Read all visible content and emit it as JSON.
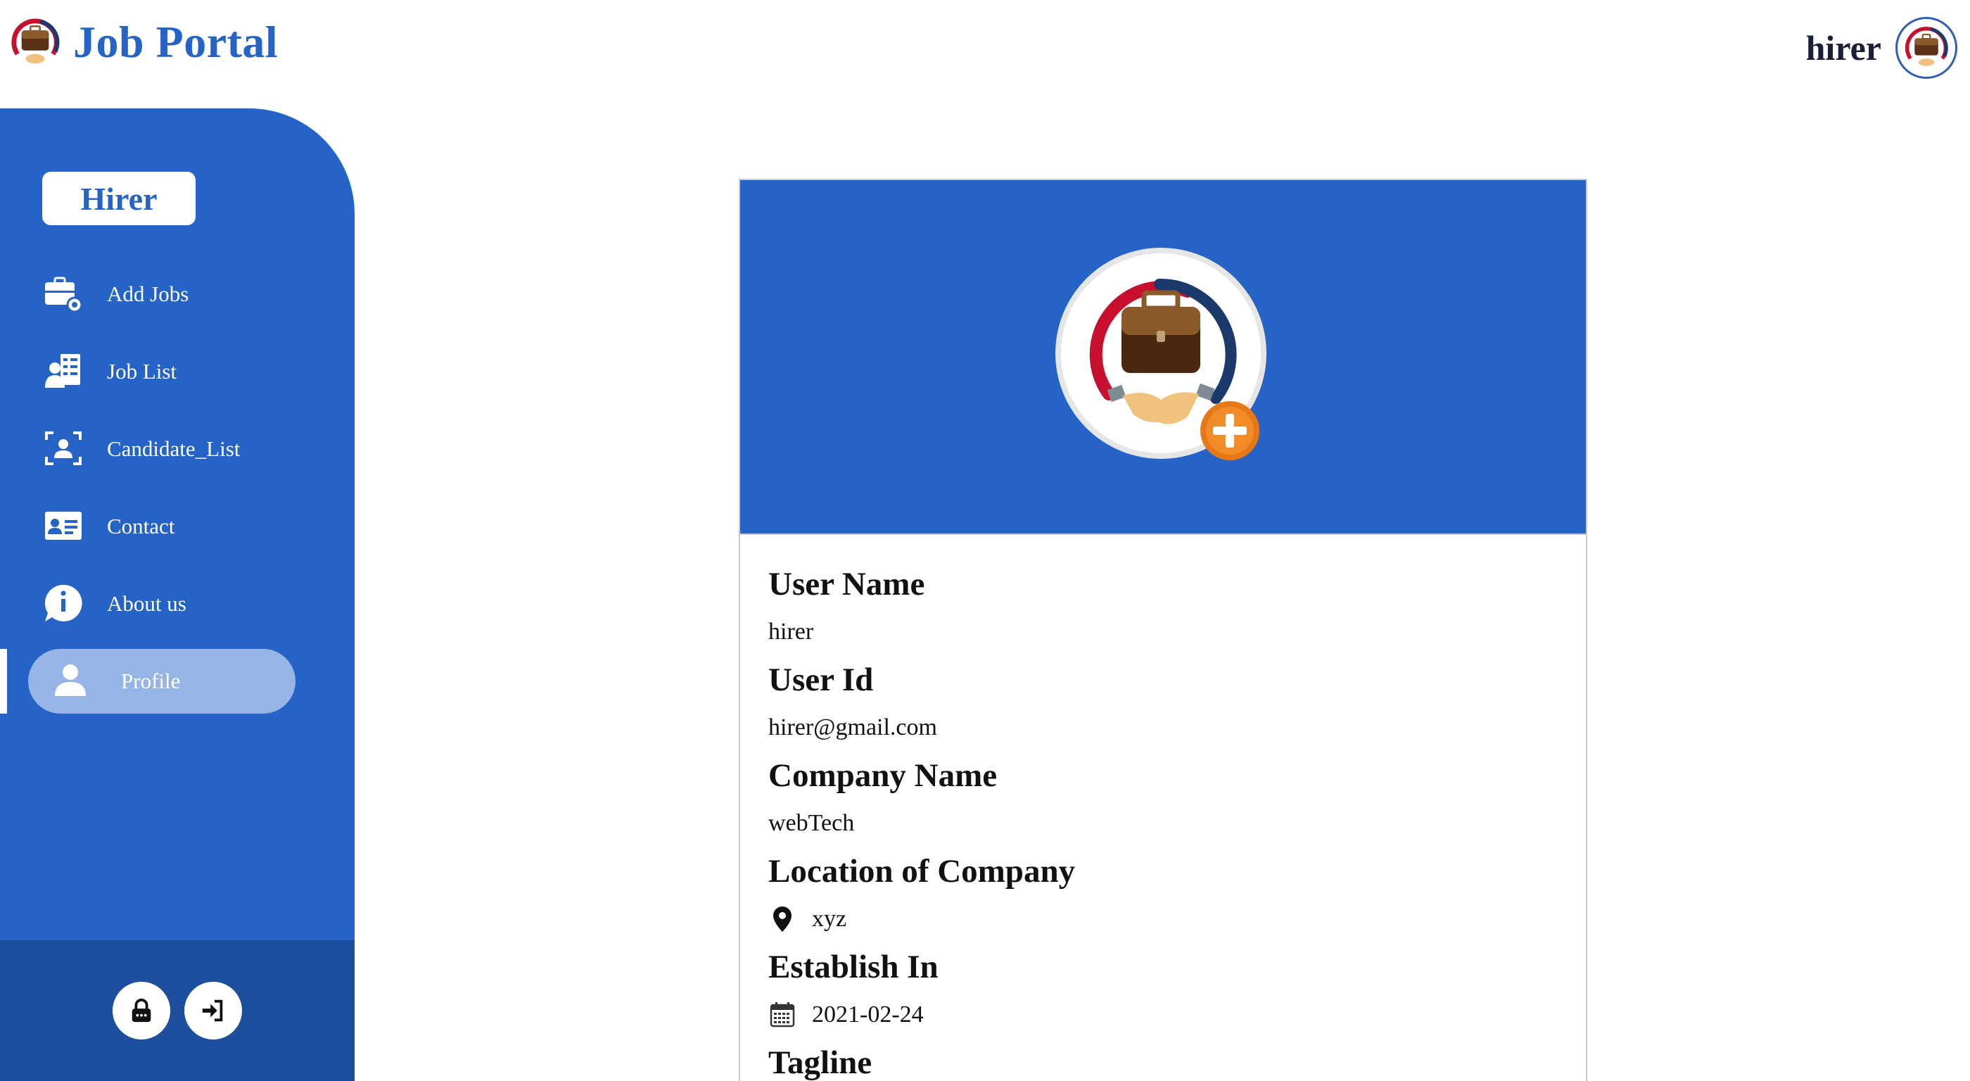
{
  "header": {
    "app_title": "Job Portal",
    "logo_icon": "job-portal-logo-icon",
    "user_name": "hirer",
    "avatar_icon": "briefcase-avatar-icon"
  },
  "sidebar": {
    "role_badge": "Hirer",
    "items": [
      {
        "label": "Add Jobs",
        "icon": "add-job-icon"
      },
      {
        "label": "Job List",
        "icon": "job-list-icon"
      },
      {
        "label": "Candidate_List",
        "icon": "candidate-scan-icon"
      },
      {
        "label": "Contact",
        "icon": "contact-card-icon"
      },
      {
        "label": "About us",
        "icon": "info-bubble-icon"
      },
      {
        "label": "Profile",
        "icon": "person-icon",
        "active": true
      }
    ],
    "footer_buttons": [
      {
        "icon": "lock-icon"
      },
      {
        "icon": "logout-icon"
      }
    ]
  },
  "profile": {
    "banner_icon": "company-logo-add-icon",
    "fields": [
      {
        "label": "User Name",
        "value": "hirer"
      },
      {
        "label": "User Id",
        "value": "hirer@gmail.com"
      },
      {
        "label": "Company Name",
        "value": "webTech"
      },
      {
        "label": "Location of Company",
        "value": "xyz",
        "icon": "location-pin-icon"
      },
      {
        "label": "Establish In",
        "value": "2021-02-24",
        "icon": "calendar-icon"
      },
      {
        "label": "Tagline",
        "value": ""
      }
    ]
  },
  "colors": {
    "primary": "#2563c6",
    "sidebar_footer": "#1e4e9e",
    "active_pill": "#96b4e6",
    "text_dark": "#111111"
  }
}
